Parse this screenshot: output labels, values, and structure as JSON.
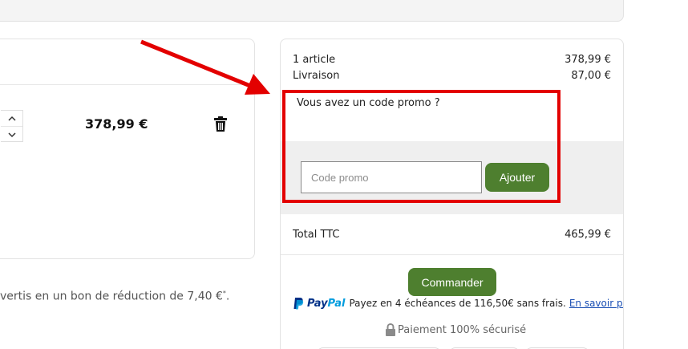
{
  "cart": {
    "item_price": "378,99 €",
    "reduction_text": "vertis en un bon de réduction de 7,40 €",
    "reduction_sup": "*",
    "stepper_up_icon": "chevron-up-icon",
    "stepper_down_icon": "chevron-down-icon",
    "delete_icon": "trash-icon"
  },
  "summary": {
    "articles_label": "1 article",
    "articles_value": "378,99 €",
    "shipping_label": "Livraison",
    "shipping_value": "87,00 €",
    "promo_question": "Vous avez un code promo ?",
    "promo_placeholder": "Code promo",
    "promo_value": "",
    "add_button": "Ajouter",
    "total_label": "Total TTC",
    "total_value": "465,99 €",
    "order_button": "Commander",
    "paypal_pay": "Pay",
    "paypal_pal": "Pal",
    "paypal_text": "Payez en 4 échéances de 116,50€ sans frais.",
    "paypal_link": "En savoir plus",
    "secure_text": "Paiement 100% sécurisé",
    "secure_icon": "lock-icon"
  },
  "colors": {
    "accent_green": "#4e7f2f",
    "highlight_red": "#e30000",
    "paypal_dark": "#003087",
    "paypal_light": "#009cde",
    "link_blue": "#1a4fb4"
  }
}
